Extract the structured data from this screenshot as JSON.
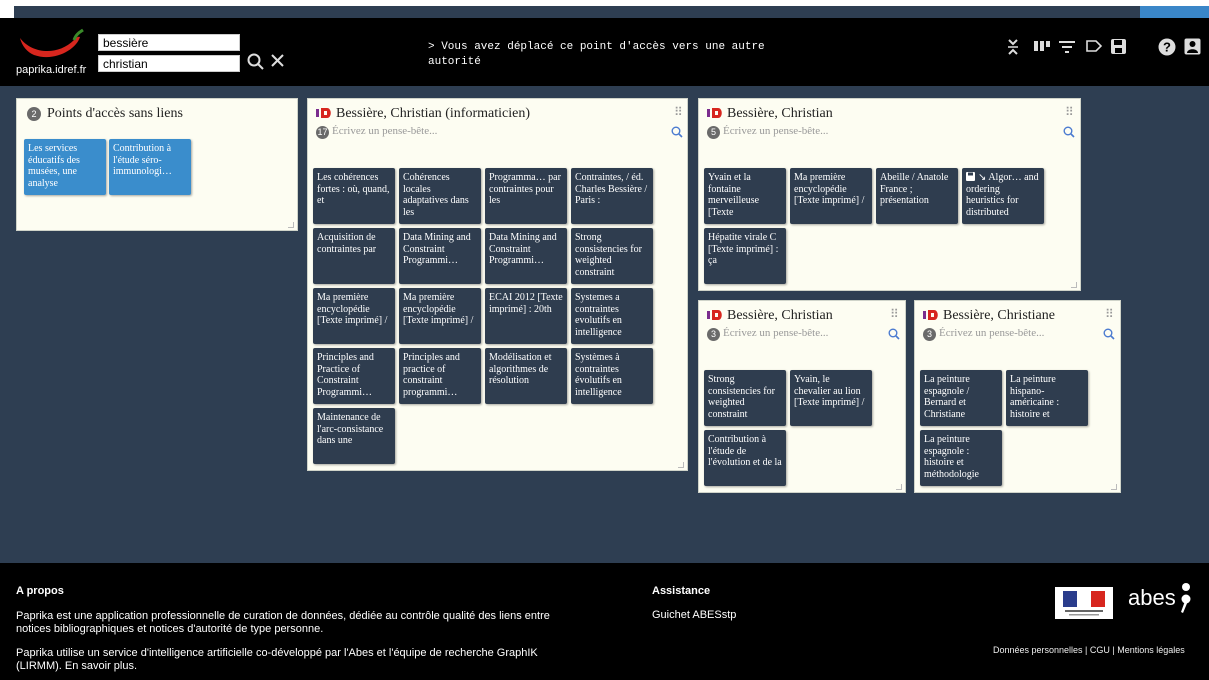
{
  "header": {
    "brand": "paprika.idref.fr",
    "search_lastname": "bessière",
    "search_firstname": "christian",
    "message": "> Vous avez déplacé ce point d'accès vers une autre autorité"
  },
  "unlinked": {
    "count": "2",
    "title": "Points d'accès sans liens",
    "cards": [
      "Les services éducatifs des musées, une analyse",
      "Contribution à l'étude séro-immunologi…"
    ]
  },
  "panel1": {
    "title": "Bessière, Christian (informaticien)",
    "count": "17",
    "note_placeholder": "Écrivez un pense-bête...",
    "cards": [
      "Les cohérences fortes : où, quand, et",
      "Cohérences locales adaptatives dans les",
      "Programma… par contraintes pour les",
      "Contraintes, / éd. Charles Bessière / Paris :",
      "Acquisition de contraintes par",
      "Data Mining and Constraint Programmi…",
      "Data Mining and Constraint Programmi…",
      "Strong consistencies for weighted constraint",
      "Ma première encyclopédie [Texte imprimé] /",
      "Ma première encyclopédie [Texte imprimé] /",
      "ECAI 2012 [Texte imprimé] : 20th",
      "Systemes a contraintes evolutifs en intelligence",
      "Principles and Practice of Constraint Programmi…",
      "Principles and practice of constraint programmi…",
      "Modélisation et algorithmes de résolution",
      "Systèmes à contraintes évolutifs en intelligence",
      "Maintenance de l'arc-consistance dans une"
    ]
  },
  "panel2": {
    "title": "Bessière, Christian",
    "count": "5",
    "note_placeholder": "Écrivez un pense-bête...",
    "cards": [
      "Yvain et la fontaine merveilleuse [Texte",
      "Ma première encyclopédie [Texte imprimé] /",
      "Abeille / Anatole France ; présentation",
      "↘ Algor… and ordering heuristics for distributed",
      "Hépatite virale C [Texte imprimé] : ça"
    ]
  },
  "panel3": {
    "title": "Bessière, Christian",
    "count": "3",
    "note_placeholder": "Écrivez un pense-bête...",
    "cards": [
      "Strong consistencies for weighted constraint",
      "Yvain, le chevalier au lion [Texte imprimé] /",
      "Contribution à l'étude de l'évolution et de la"
    ]
  },
  "panel4": {
    "title": "Bessière, Christiane",
    "count": "3",
    "note_placeholder": "Écrivez un pense-bête...",
    "cards": [
      "La peinture espagnole / Bernard et Christiane",
      "La peinture hispano-américaine : histoire et",
      "La peinture espagnole : histoire et méthodologie"
    ]
  },
  "footer": {
    "about_title": "A propos",
    "about_p1": "Paprika est une application professionnelle de curation de données, dédiée au contrôle qualité des liens entre notices bibliographiques et notices d'autorité de type personne.",
    "about_p2": "Paprika utilise un service d'intelligence artificielle co-développé par l'Abes et l'équipe de recherche GraphIK (LIRMM). En savoir plus.",
    "assist_title": "Assistance",
    "assist_link": "Guichet ABESstp",
    "abes_logo": "abes",
    "legal": "Données personnelles | CGU | Mentions légales"
  },
  "colors": {
    "header_bg": "#000000",
    "body_bg": "#2e3e52",
    "card_bg": "#2f3d4f",
    "card_blue": "#3a8dcc",
    "accent": "#3a86c8",
    "logo_red": "#d7261e"
  },
  "icons": [
    "search-icon",
    "clear-icon",
    "collapse-icon",
    "columns-icon",
    "filter-icon",
    "label-icon",
    "save-icon",
    "help-icon",
    "user-icon",
    "idref-icon",
    "drag-handle-icon",
    "zoom-icon"
  ]
}
